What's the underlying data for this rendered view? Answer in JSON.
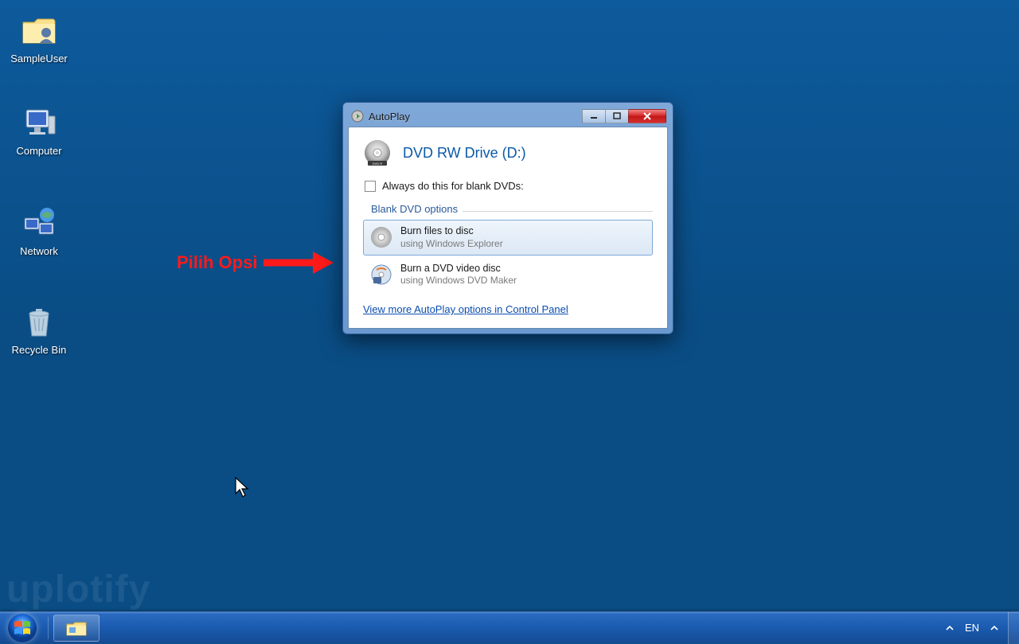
{
  "desktop": {
    "icons": [
      {
        "label": "SampleUser"
      },
      {
        "label": "Computer"
      },
      {
        "label": "Network"
      },
      {
        "label": "Recycle Bin"
      }
    ]
  },
  "autoplay": {
    "title": "AutoPlay",
    "drive_title": "DVD RW Drive (D:)",
    "always_label": "Always do this for blank DVDs:",
    "section_label": "Blank DVD options",
    "options": [
      {
        "title": "Burn files to disc",
        "sub": "using Windows Explorer"
      },
      {
        "title": "Burn a DVD video disc",
        "sub": "using Windows DVD Maker"
      }
    ],
    "link": "View more AutoPlay options in Control Panel"
  },
  "annotation": {
    "text": "Pilih Opsi"
  },
  "taskbar": {
    "lang": "EN"
  },
  "watermark": "uplotify"
}
